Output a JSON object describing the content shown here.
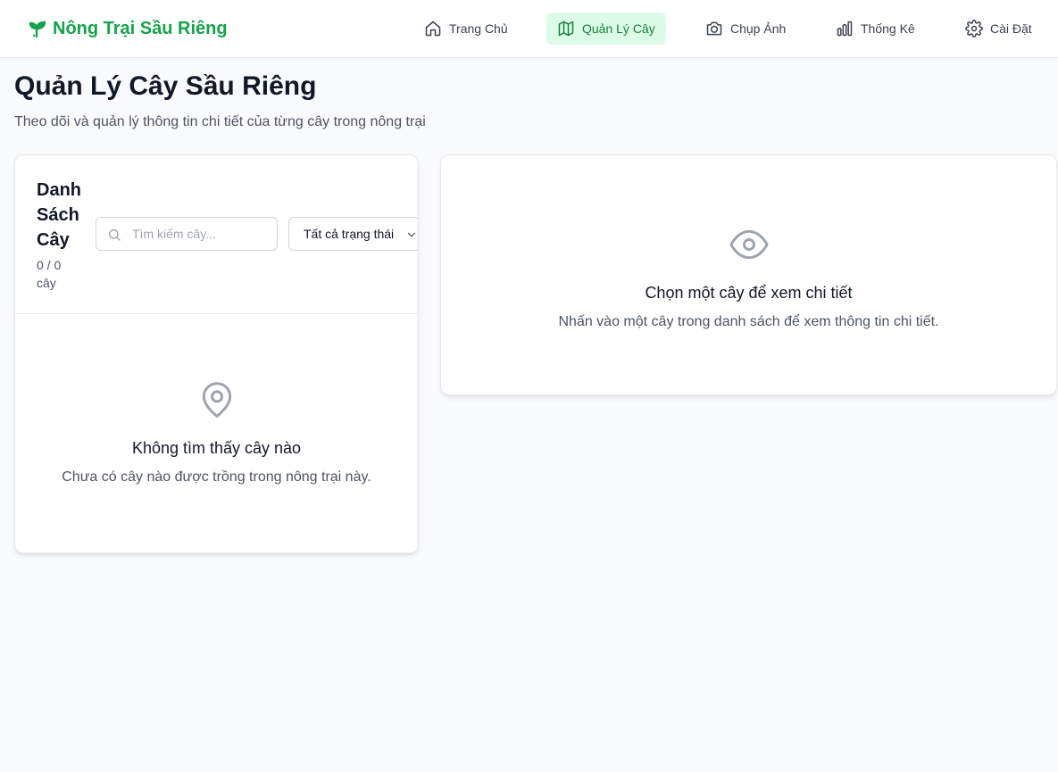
{
  "app": {
    "brand": "Nông Trại Sầu Riêng"
  },
  "nav": {
    "items": [
      {
        "label": "Trang Chủ",
        "icon": "home-icon",
        "active": false
      },
      {
        "label": "Quản Lý Cây",
        "icon": "map-icon",
        "active": true
      },
      {
        "label": "Chụp Ảnh",
        "icon": "camera-icon",
        "active": false
      },
      {
        "label": "Thống Kê",
        "icon": "bar-chart-icon",
        "active": false
      },
      {
        "label": "Cài Đặt",
        "icon": "gear-icon",
        "active": false
      }
    ]
  },
  "page": {
    "title": "Quản Lý Cây Sầu Riêng",
    "subtitle": "Theo dõi và quản lý thông tin chi tiết của từng cây trong nông trại"
  },
  "tree_list": {
    "title": "Danh Sách Cây",
    "count": "0 / 0 cây",
    "search_placeholder": "Tìm kiếm cây...",
    "search_value": "",
    "status_filter": "Tất cả trạng thái",
    "empty_title": "Không tìm thấy cây nào",
    "empty_desc": "Chưa có cây nào được trồng trong nông trại này."
  },
  "detail": {
    "empty_title": "Chọn một cây để xem chi tiết",
    "empty_desc": "Nhấn vào một cây trong danh sách để xem thông tin chi tiết."
  },
  "colors": {
    "brand": "#16a34a",
    "active_bg": "#dcfce7",
    "active_text": "#15803d",
    "muted_icon": "#9ca3af"
  }
}
